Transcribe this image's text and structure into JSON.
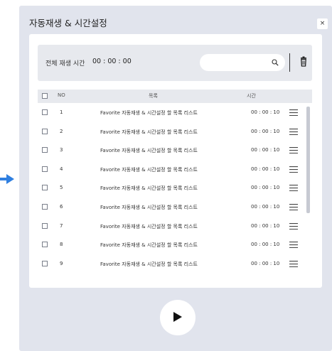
{
  "modal": {
    "title": "자동재생 & 시간설정",
    "close_label": "×"
  },
  "toolbar": {
    "total_label": "전체 재생 시간",
    "total_time": "00 : 00 : 00",
    "search_value": "",
    "search_placeholder": ""
  },
  "table": {
    "headers": {
      "no": "NO",
      "item": "목록",
      "time": "시간"
    },
    "rows": [
      {
        "no": "1",
        "title": "Favorite 자동재생 & 시간설정 할 목록 리스트",
        "time": "00 : 00 : 10"
      },
      {
        "no": "2",
        "title": "Favorite 자동재생 & 시간설정 할 목록 리스트",
        "time": "00 : 00 : 10"
      },
      {
        "no": "3",
        "title": "Favorite 자동재생 & 시간설정 할 목록 리스트",
        "time": "00 : 00 : 10"
      },
      {
        "no": "4",
        "title": "Favorite 자동재생 & 시간설정 할 목록 리스트",
        "time": "00 : 00 : 10"
      },
      {
        "no": "5",
        "title": "Favorite 자동재생 & 시간설정 할 목록 리스트",
        "time": "00 : 00 : 10"
      },
      {
        "no": "6",
        "title": "Favorite 자동재생 & 시간설정 할 목록 리스트",
        "time": "00 : 00 : 10"
      },
      {
        "no": "7",
        "title": "Favorite 자동재생 & 시간설정 할 목록 리스트",
        "time": "00 : 00 : 10"
      },
      {
        "no": "8",
        "title": "Favorite 자동재생 & 시간설정 할 목록 리스트",
        "time": "00 : 00 : 10"
      },
      {
        "no": "9",
        "title": "Favorite 자동재생 & 시간설정 할 목록 리스트",
        "time": "00 : 00 : 10"
      }
    ]
  },
  "icons": {
    "arrow": "arrow-right-icon",
    "close": "close-icon",
    "search": "search-icon",
    "trash": "trash-icon",
    "drag": "menu-icon",
    "play": "play-icon"
  },
  "colors": {
    "accent_arrow": "#2f7fe0",
    "modal_bg": "#e1e4ed",
    "panel_bg": "#ffffff"
  }
}
